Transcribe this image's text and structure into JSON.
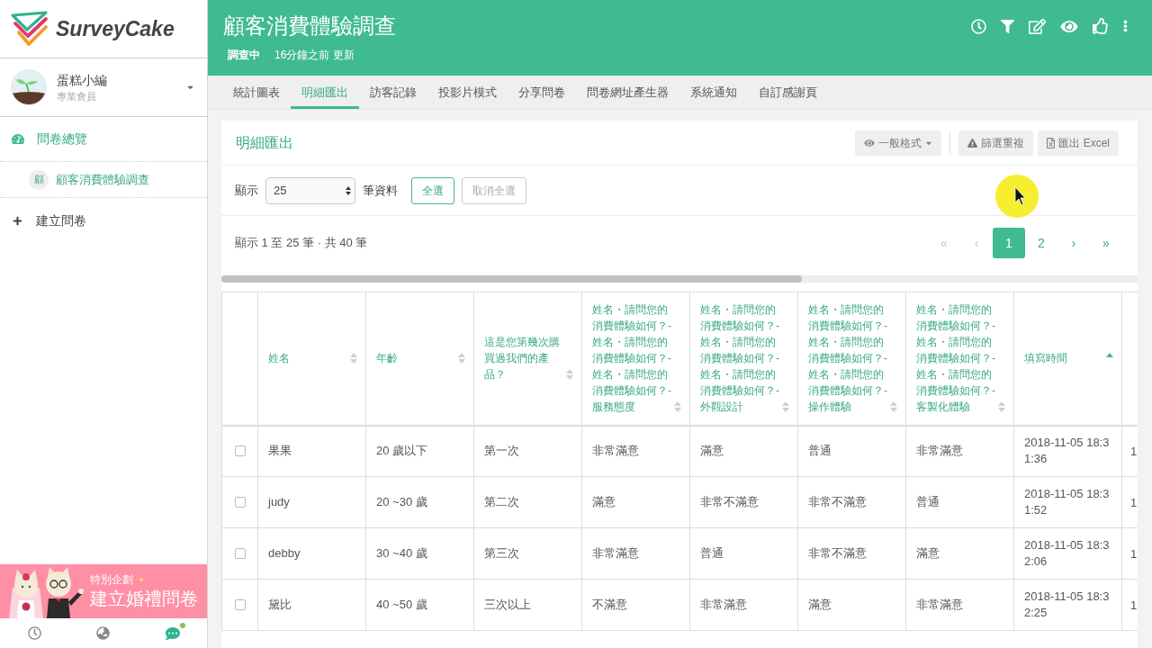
{
  "sidebar": {
    "brand": "SurveyCake",
    "user": {
      "name": "蛋糕小編",
      "role": "專業會員"
    },
    "nav": [
      {
        "kind": "overview",
        "label": "問卷總覽"
      },
      {
        "kind": "survey",
        "badge": "顧",
        "label": "顧客消費體驗調查"
      },
      {
        "kind": "create",
        "label": "建立問卷"
      }
    ],
    "banner": {
      "kicker": "特別企劃",
      "title": "建立婚禮問卷"
    },
    "footer": {
      "chat_notification": true
    }
  },
  "header": {
    "title": "顧客消費體驗調查",
    "status": "調查中",
    "updated": "16分鐘之前 更新"
  },
  "tabs": [
    {
      "label": "統計圖表",
      "selected": false
    },
    {
      "label": "明細匯出",
      "selected": true
    },
    {
      "label": "訪客記錄",
      "selected": false
    },
    {
      "label": "投影片模式",
      "selected": false
    },
    {
      "label": "分享問卷",
      "selected": false
    },
    {
      "label": "問卷網址產生器",
      "selected": false
    },
    {
      "label": "系統通知",
      "selected": false
    },
    {
      "label": "自訂感謝頁",
      "selected": false
    }
  ],
  "panel": {
    "title": "明細匯出",
    "actions": [
      {
        "kind": "format",
        "label": "一般格式"
      },
      {
        "kind": "duplicates",
        "label": "篩選重複"
      },
      {
        "kind": "excel",
        "label": "匯出 Excel"
      }
    ],
    "page_size": {
      "label": "顯示",
      "value": "25",
      "unit": "筆資料"
    },
    "select_buttons": [
      {
        "label": "全選",
        "disabled": false
      },
      {
        "label": "取消全選",
        "disabled": true
      }
    ],
    "summary": "顯示 1 至 25 筆 · 共 40 筆",
    "pagination": [
      {
        "label": "«",
        "selected": false,
        "disabled": true
      },
      {
        "label": "‹",
        "selected": false,
        "disabled": true
      },
      {
        "label": "1",
        "selected": true,
        "disabled": false
      },
      {
        "label": "2",
        "selected": false,
        "disabled": false
      },
      {
        "label": "›",
        "selected": false,
        "disabled": false
      },
      {
        "label": "»",
        "selected": false,
        "disabled": false
      }
    ]
  },
  "table": {
    "columns": [
      {
        "kind": "text",
        "label": "姓名",
        "sorted": false
      },
      {
        "kind": "text",
        "label": "年齡",
        "sorted": false
      },
      {
        "kind": "text",
        "label": "這是您第幾次購買過我們的產品？",
        "sorted": false
      },
      {
        "kind": "text",
        "label": "姓名・請問您的消費體驗如何？-姓名・請問您的消費體驗如何？-姓名・請問您的消費體驗如何？-服務態度",
        "sorted": false
      },
      {
        "kind": "text",
        "label": "姓名・請問您的消費體驗如何？-姓名・請問您的消費體驗如何？-姓名・請問您的消費體驗如何？-外觀設計",
        "sorted": false
      },
      {
        "kind": "text",
        "label": "姓名・請問您的消費體驗如何？-姓名・請問您的消費體驗如何？-姓名・請問您的消費體驗如何？-操作體驗",
        "sorted": false
      },
      {
        "kind": "text",
        "label": "姓名・請問您的消費體驗如何？-姓名・請問您的消費體驗如何？-姓名・請問您的消費體驗如何？-客製化體驗",
        "sorted": false
      },
      {
        "kind": "text",
        "label": "填寫時間",
        "sorted": true
      },
      {
        "kind": "clipped"
      }
    ],
    "rows": [
      {
        "checked": false,
        "cells": [
          "果果",
          "20 歲以下",
          "第一次",
          "非常滿意",
          "滿意",
          "普通",
          "非常滿意",
          "2018-11-05 18:31:36",
          "1"
        ]
      },
      {
        "checked": false,
        "cells": [
          "judy",
          "20 ~30 歲",
          "第二次",
          "滿意",
          "非常不滿意",
          "非常不滿意",
          "普通",
          "2018-11-05 18:31:52",
          "1"
        ]
      },
      {
        "checked": false,
        "cells": [
          "debby",
          "30 ~40 歲",
          "第三次",
          "非常滿意",
          "普通",
          "非常不滿意",
          "滿意",
          "2018-11-05 18:32:06",
          "1"
        ]
      },
      {
        "checked": false,
        "cells": [
          "黛比",
          "40 ~50 歲",
          "三次以上",
          "不滿意",
          "非常滿意",
          "滿意",
          "非常滿意",
          "2018-11-05 18:32:25",
          "1"
        ]
      }
    ]
  }
}
